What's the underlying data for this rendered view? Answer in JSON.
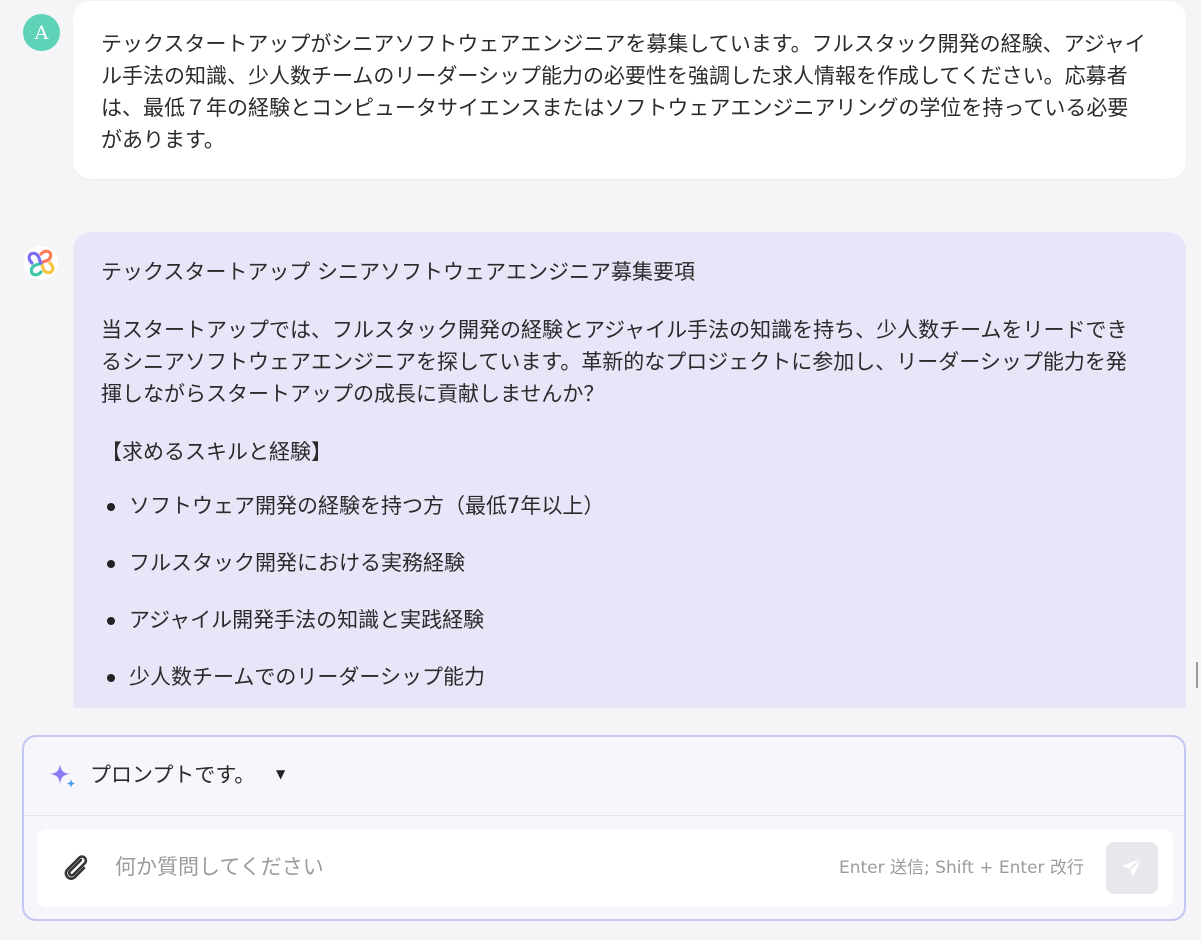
{
  "user_message": {
    "avatar_initial": "A",
    "text": "テックスタートアップがシニアソフトウェアエンジニアを募集しています。フルスタック開発の経験、アジャイル手法の知識、少人数チームのリーダーシップ能力の必要性を強調した求人情報を作成してください。応募者は、最低７年の経験とコンピュータサイエンスまたはソフトウェアエンジニアリングの学位を持っている必要があります。"
  },
  "ai_message": {
    "title": "テックスタートアップ シニアソフトウェアエンジニア募集要項",
    "intro": "当スタートアップでは、フルスタック開発の経験とアジャイル手法の知識を持ち、少人数チームをリードできるシニアソフトウェアエンジニアを探しています。革新的なプロジェクトに参加し、リーダーシップ能力を発揮しながらスタートアップの成長に貢献しませんか？",
    "section_heading": "【求めるスキルと経験】",
    "requirements": [
      "ソフトウェア開発の経験を持つ方（最低7年以上）",
      "フルスタック開発における実務経験",
      "アジャイル開発手法の知識と実践経験",
      "少人数チームでのリーダーシップ能力"
    ]
  },
  "composer": {
    "prompt_selector_label": "プロンプトです。",
    "input_value": "",
    "input_placeholder": "何か質問してください",
    "hint": "Enter 送信; Shift + Enter 改行"
  },
  "colors": {
    "user_avatar": "#5fd3b8",
    "ai_bubble": "#e8e5f8",
    "composer_border": "#c4c6f3",
    "sparkle_purple": "#8b7cf6",
    "sparkle_blue": "#4b9df0"
  },
  "icons": {
    "ai_avatar": "colorful-knot-logo-icon",
    "prompt": "sparkle-icon",
    "prompt_dropdown": "caret-down-icon",
    "attach": "paperclip-icon",
    "send": "paper-plane-icon"
  }
}
